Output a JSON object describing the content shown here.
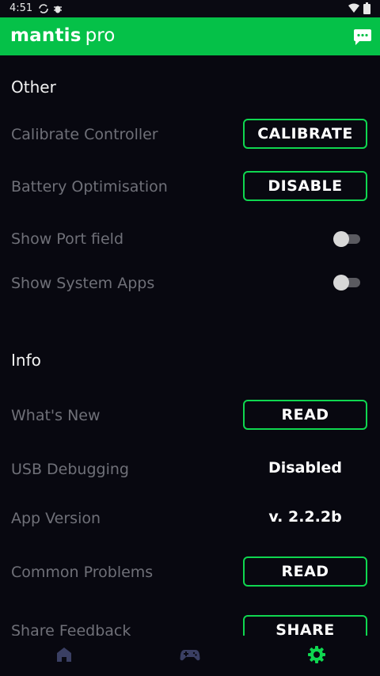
{
  "status_bar": {
    "time": "4:51",
    "left_icons": [
      "sync-icon",
      "bug-icon"
    ],
    "right_icons": [
      "wifi-icon",
      "battery-icon"
    ]
  },
  "app_bar": {
    "brand_main": "mantis",
    "brand_suffix": "pro",
    "background": "#05c148",
    "action_icon": "chat-icon"
  },
  "sections": {
    "other": {
      "title": "Other",
      "calibrate": {
        "label": "Calibrate Controller",
        "button": "CALIBRATE"
      },
      "battery": {
        "label": "Battery Optimisation",
        "button": "DISABLE"
      },
      "port_field": {
        "label": "Show Port field",
        "enabled": false
      },
      "system_apps": {
        "label": "Show System Apps",
        "enabled": false
      }
    },
    "info": {
      "title": "Info",
      "whats_new": {
        "label": "What's New",
        "button": "READ"
      },
      "usb_debugging": {
        "label": "USB Debugging",
        "value": "Disabled"
      },
      "app_version": {
        "label": "App Version",
        "value": "v. 2.2.2b"
      },
      "common_problems": {
        "label": "Common Problems",
        "button": "READ"
      },
      "share_feedback": {
        "label": "Share Feedback",
        "button": "SHARE"
      }
    }
  },
  "bottom_nav": {
    "items": [
      {
        "icon": "home-icon",
        "active": false
      },
      {
        "icon": "gamepad-icon",
        "active": false
      },
      {
        "icon": "settings-icon",
        "active": true
      }
    ],
    "active_color": "#0fd750",
    "inactive_color": "#3a3f63"
  },
  "colors": {
    "accent": "#0fd750",
    "background": "#080810",
    "label": "#6f7078"
  }
}
